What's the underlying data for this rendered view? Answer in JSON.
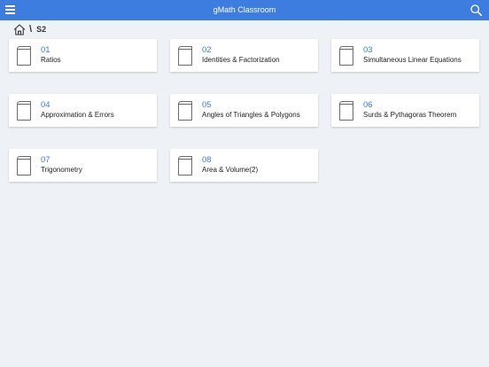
{
  "header": {
    "title": "gMath Classroom",
    "menu_icon": "hamburger-menu-icon",
    "search_icon": "search-icon",
    "bar_color": "#3d7de0"
  },
  "breadcrumb": {
    "home_icon": "home-icon",
    "separator": "\\",
    "current": "S2"
  },
  "chapters": [
    {
      "num": "01",
      "name": "Ratios"
    },
    {
      "num": "02",
      "name": "Identities & Factorization"
    },
    {
      "num": "03",
      "name": "Simultaneous Linear Equations"
    },
    {
      "num": "04",
      "name": "Approximation & Errors"
    },
    {
      "num": "05",
      "name": "Angles of Triangles & Polygons"
    },
    {
      "num": "06",
      "name": "Surds & Pythagoras Theorem"
    },
    {
      "num": "07",
      "name": "Trigonometry"
    },
    {
      "num": "08",
      "name": "Area & Volume(2)"
    }
  ],
  "colors": {
    "accent": "#3d7de0",
    "background": "#eef1f5",
    "card": "#ffffff"
  }
}
